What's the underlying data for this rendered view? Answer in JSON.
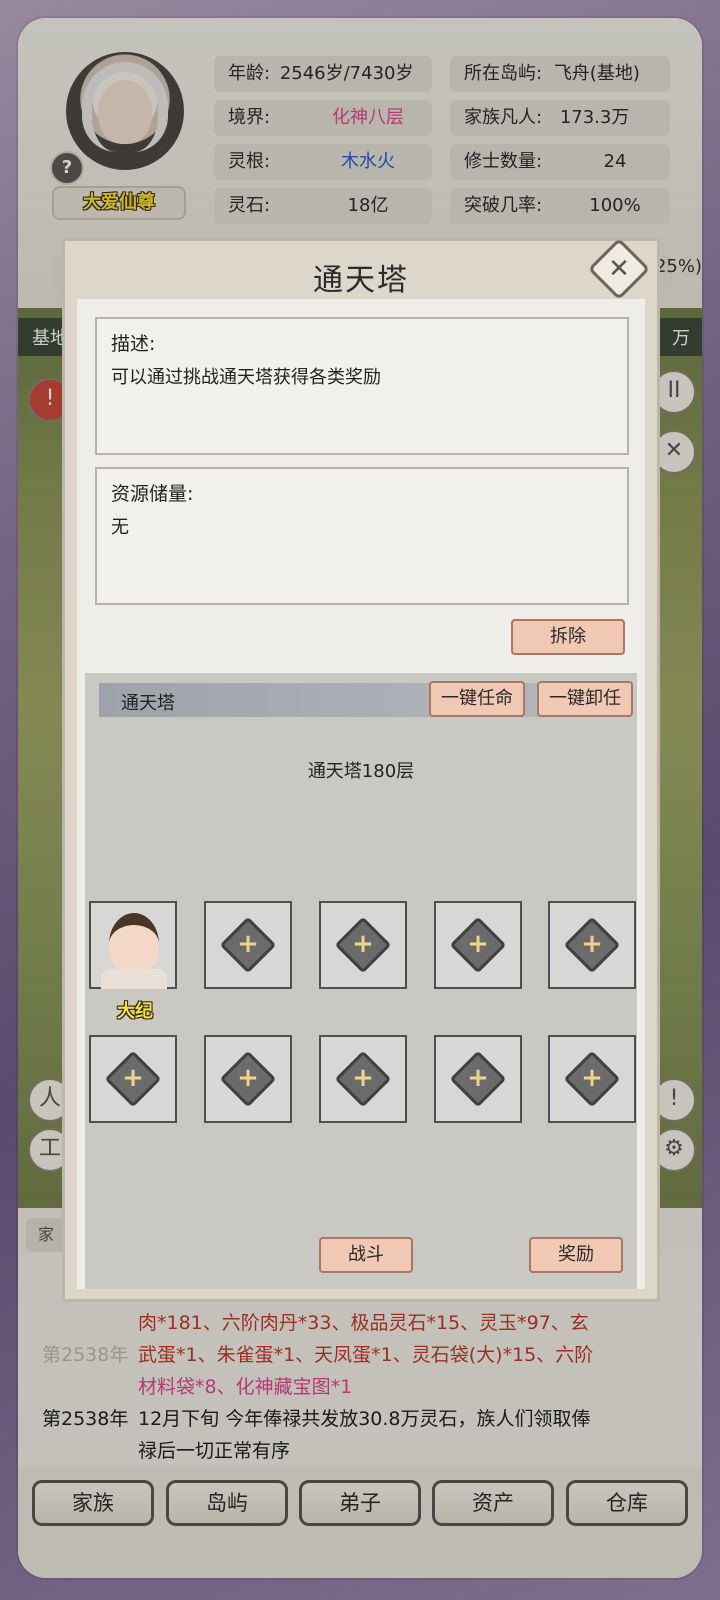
{
  "player": {
    "name": "大爱仙尊",
    "help_glyph": "?"
  },
  "stats": {
    "age_label": "年龄:",
    "age_value": "2546岁/7430岁",
    "island_label": "所在岛屿:",
    "island_value": "飞舟(基地)",
    "realm_label": "境界:",
    "realm_value": "化神八层",
    "family_label": "家族凡人:",
    "family_value": "173.3万",
    "root_label": "灵根:",
    "root_value": "木水火",
    "cultivator_label": "修士数量:",
    "cultivator_value": "24",
    "stone_label": "灵石:",
    "stone_value": "18亿",
    "breakthrough_label": "突破几率:",
    "breakthrough_value": "100%",
    "peek_percent": ".25%)"
  },
  "map": {
    "left_label": "基地",
    "right_label": "万",
    "pause_glyph": "II",
    "close_glyph": "✕"
  },
  "dialog": {
    "title": "通天塔",
    "close_glyph": "✕",
    "desc_title": "描述:",
    "desc_text": "可以通过挑战通天塔获得各类奖励",
    "res_title": "资源储量:",
    "res_text": "无",
    "demolish_label": "拆除",
    "section_label": "通天塔",
    "appoint_all_label": "一键任命",
    "dismiss_all_label": "一键卸任",
    "floor_label": "通天塔180层",
    "disciple_name": "大纪",
    "plus_glyph": "+",
    "battle_label": "战斗",
    "reward_label": "奖励"
  },
  "log": {
    "tab_label": "家",
    "line1_text": "武蛋*1、朱雀蛋*1、天凤蛋*1、灵石袋(大)*15、六阶",
    "line2_text": "材料袋*8、化神藏宝图*1",
    "line3_year": "第2538年",
    "line3_text": "12月下旬 今年俸禄共发放30.8万灵石，族人们领取俸",
    "line4_text": "禄后一切正常有序",
    "top_partial": "肉*181、六阶肉丹*33、极品灵石*15、灵玉*97、玄",
    "faded_year": "第2538年"
  },
  "nav": {
    "family": "家族",
    "island": "岛屿",
    "disciple": "弟子",
    "asset": "资产",
    "warehouse": "仓库"
  },
  "colors": {
    "accent_pink": "#e0468e",
    "accent_blue": "#2d5bd1",
    "name_yellow": "#f7df3a",
    "button_salmon": "#f1c8b3"
  }
}
